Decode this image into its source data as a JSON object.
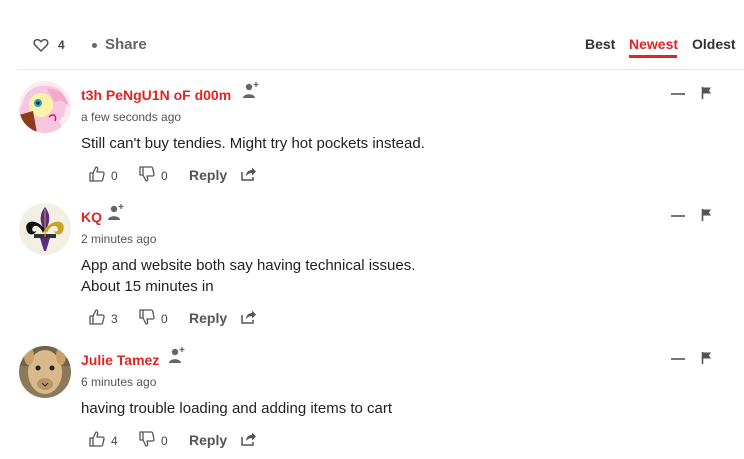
{
  "header": {
    "like_count": "4",
    "share_label": "Share",
    "sort_tabs": [
      "Best",
      "Newest",
      "Oldest"
    ],
    "active_sort": "Newest",
    "accent_color": "#e02424"
  },
  "comments": [
    {
      "author": "t3h PeNgU1N oF d00m",
      "time": "a few seconds ago",
      "text": [
        "Still can't buy tendies. Might try hot pockets instead."
      ],
      "upvotes": "0",
      "downvotes": "0",
      "reply_label": "Reply"
    },
    {
      "author": "KQ",
      "time": "2 minutes ago",
      "text": [
        "App and website both say having technical issues.",
        "About 15 minutes in"
      ],
      "upvotes": "3",
      "downvotes": "0",
      "reply_label": "Reply"
    },
    {
      "author": "Julie Tamez",
      "time": "6 minutes ago",
      "text": [
        "having trouble loading and adding items to cart"
      ],
      "upvotes": "4",
      "downvotes": "0",
      "reply_label": "Reply"
    }
  ]
}
